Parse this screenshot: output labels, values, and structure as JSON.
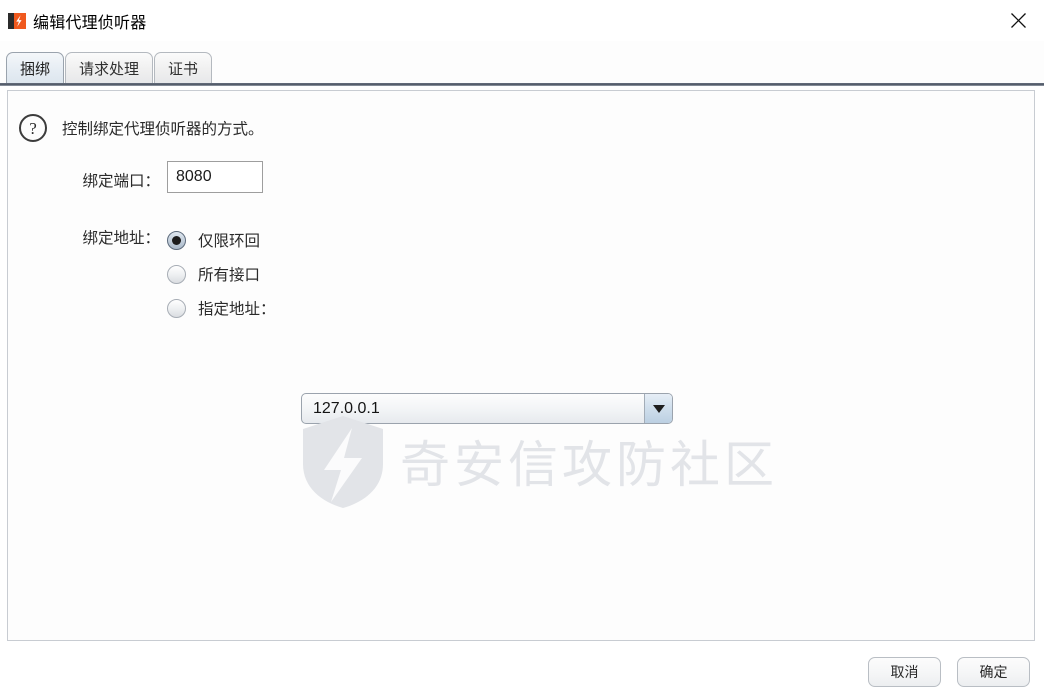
{
  "window": {
    "title": "编辑代理侦听器",
    "icon": "burp-suite-logo-icon",
    "close_label": "×"
  },
  "tabs": [
    {
      "label": "捆绑",
      "active": true
    },
    {
      "label": "请求处理",
      "active": false
    },
    {
      "label": "证书",
      "active": false
    }
  ],
  "content": {
    "help_icon": "question-mark-icon",
    "help_text": "控制绑定代理侦听器的方式。",
    "port": {
      "label": "绑定端口：",
      "value": "8080"
    },
    "bind_address": {
      "label": "绑定地址：",
      "options": [
        {
          "label": "仅限环回",
          "selected": true
        },
        {
          "label": "所有接口",
          "selected": false
        },
        {
          "label": "指定地址：",
          "selected": false
        }
      ],
      "combo": {
        "value": "127.0.0.1",
        "arrow_icon": "chevron-down-icon"
      }
    }
  },
  "watermark": {
    "text": "奇安信攻防社区",
    "logo": "shield-lightning-icon"
  },
  "footer": {
    "buttons": [
      {
        "label": "取消"
      },
      {
        "label": "确定"
      }
    ]
  },
  "colors": {
    "accent": "#4a5260",
    "tab_active_bg": "#e5ecf3",
    "panel_border": "#c8ccd2",
    "watermark": "#e2e4e8",
    "logo_orange": "#f0591e"
  }
}
